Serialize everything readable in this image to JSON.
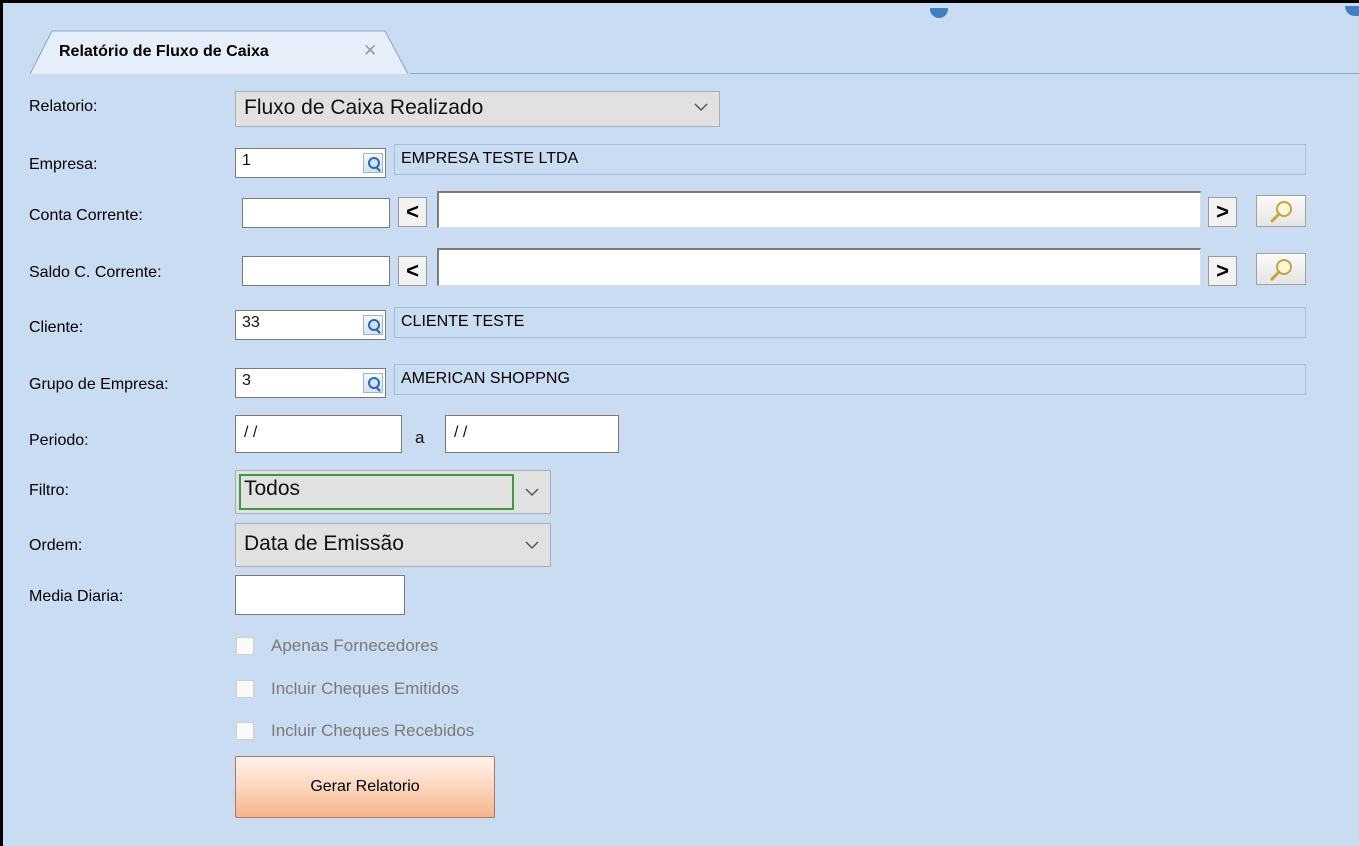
{
  "tab": {
    "title": "Relatório de Fluxo de Caixa",
    "close_glyph": "✕"
  },
  "labels": {
    "relatorio": "Relatorio:",
    "empresa": "Empresa:",
    "conta_corrente": "Conta Corrente:",
    "saldo_corrente": "Saldo C. Corrente:",
    "cliente": "Cliente:",
    "grupo_empresa": "Grupo de Empresa:",
    "periodo": "Periodo:",
    "filtro": "Filtro:",
    "ordem": "Ordem:",
    "media_diaria": "Media Diaria:"
  },
  "relatorio": {
    "selected": "Fluxo de Caixa Realizado"
  },
  "empresa": {
    "code": "1",
    "name": "EMPRESA TESTE LTDA"
  },
  "conta_corrente": {
    "code": "",
    "prev_glyph": "<",
    "next_glyph": ">"
  },
  "saldo_corrente": {
    "code": "",
    "prev_glyph": "<",
    "next_glyph": ">"
  },
  "cliente": {
    "code": "33",
    "name": "CLIENTE TESTE"
  },
  "grupo_empresa": {
    "code": "3",
    "name": "AMERICAN SHOPPNG"
  },
  "periodo": {
    "start": " / /",
    "separator": "a",
    "end": " / /"
  },
  "filtro": {
    "selected": "Todos"
  },
  "ordem": {
    "selected": "Data de Emissão"
  },
  "media_diaria": {
    "value": ""
  },
  "checkboxes": [
    {
      "label": "Apenas Fornecedores",
      "checked": false
    },
    {
      "label": "Incluir Cheques Emitidos",
      "checked": false
    },
    {
      "label": "Incluir Cheques Recebidos",
      "checked": false
    }
  ],
  "actions": {
    "generate_label": "Gerar Relatorio"
  },
  "colors": {
    "background": "#c9dcf2",
    "button_accent": "#f5b48d",
    "focus_border": "#3c9a3c"
  }
}
